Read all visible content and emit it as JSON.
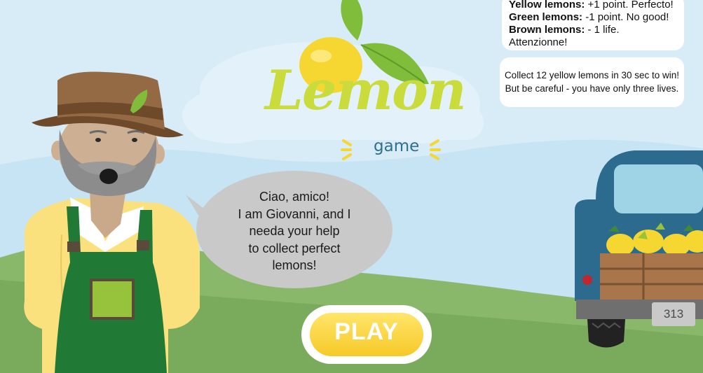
{
  "rules": [
    {
      "label": "Yellow lemons:",
      "text": " +1 point. Perfecto!"
    },
    {
      "label": "Green lemons:",
      "text": " -1 point. No good!"
    },
    {
      "label": "Brown lemons:",
      "text": " - 1 life. Attenzionne!"
    }
  ],
  "goal": {
    "line1": "Collect 12 yellow lemons in 30 sec to win!",
    "line2": "But be careful - you have only three lives."
  },
  "logo": {
    "word": "Lemon",
    "subtitle": "game"
  },
  "speech": {
    "lines": [
      "Ciao, amico!",
      "I am Giovanni, and I",
      "needa your help",
      "to collect perfect",
      "lemons!"
    ]
  },
  "play_button": {
    "label": "PLAY"
  },
  "truck": {
    "plate": "313"
  },
  "colors": {
    "sky": "#d8ecf7",
    "hill": "#8ab86a",
    "lemon_yellow": "#f6d631",
    "logo_green": "#c9dc3b",
    "truck_blue": "#2c6a8e",
    "overalls_green": "#207a35",
    "shirt_yellow": "#fbe17d"
  }
}
